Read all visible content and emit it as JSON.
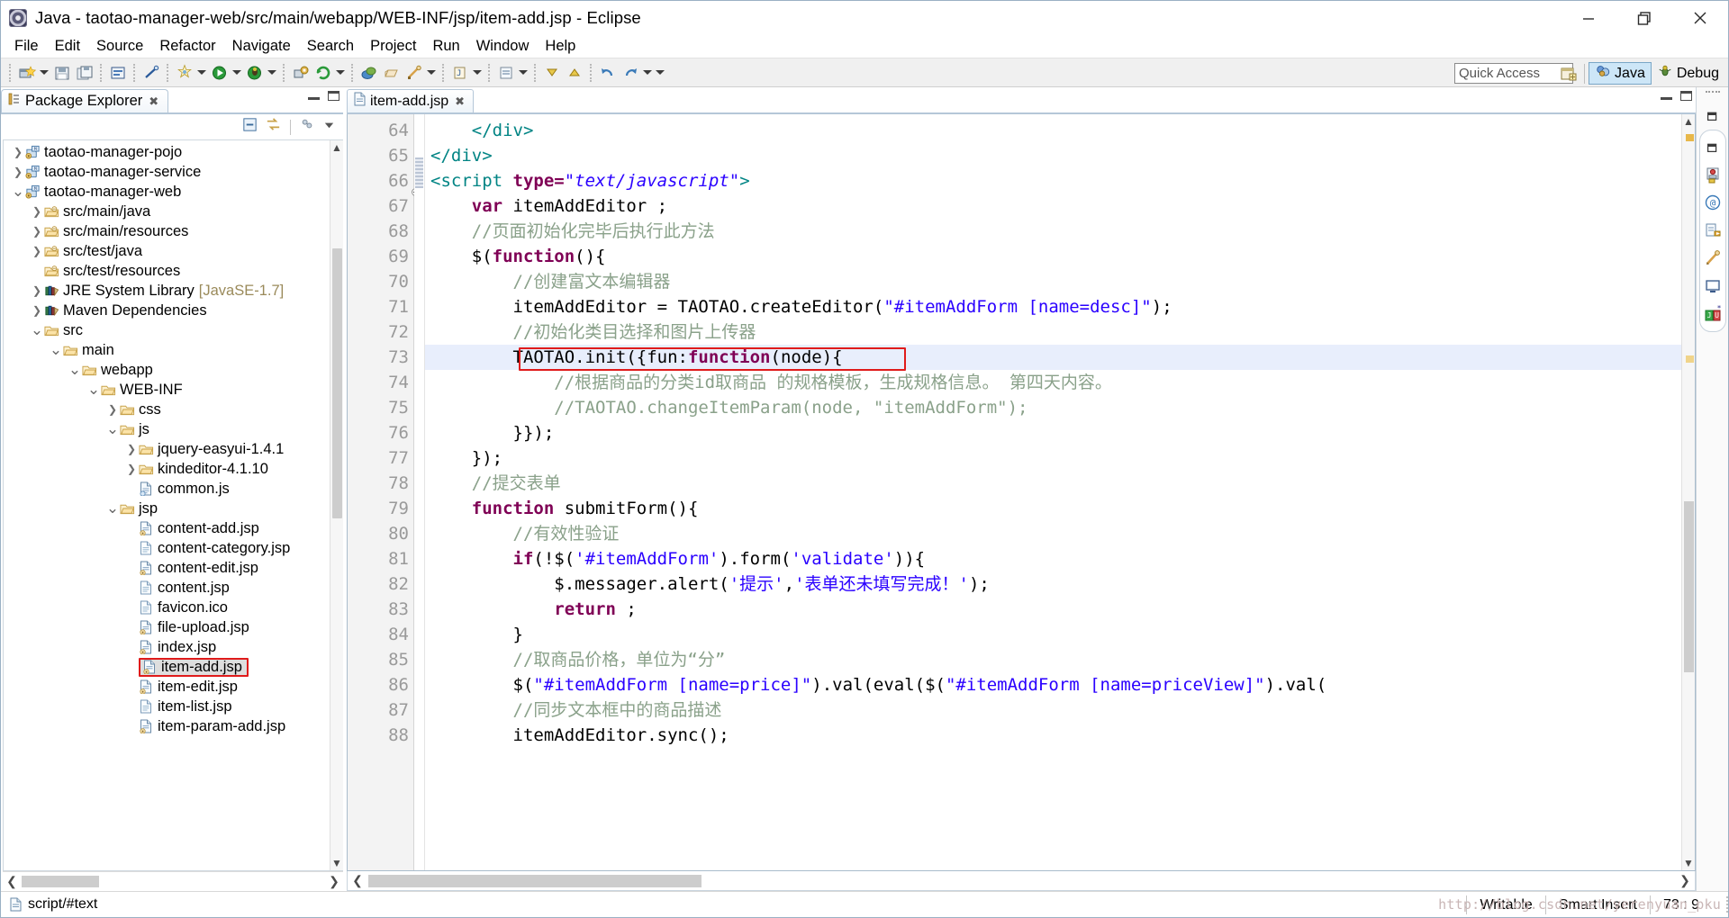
{
  "window": {
    "title": "Java - taotao-manager-web/src/main/webapp/WEB-INF/jsp/item-add.jsp - Eclipse",
    "app_icon": "eclipse-icon",
    "minimize": "—",
    "maximize": "❐",
    "close": "✕"
  },
  "menubar": {
    "items": [
      {
        "label": "File"
      },
      {
        "label": "Edit"
      },
      {
        "label": "Source"
      },
      {
        "label": "Refactor"
      },
      {
        "label": "Navigate"
      },
      {
        "label": "Search"
      },
      {
        "label": "Project"
      },
      {
        "label": "Run"
      },
      {
        "label": "Window"
      },
      {
        "label": "Help"
      }
    ]
  },
  "toolbar": {
    "quick_access_placeholder": "Quick Access",
    "open_perspective_icon": "open-perspective-icon",
    "perspectives": [
      {
        "label": "Java",
        "icon": "java-perspective-icon",
        "active": true
      },
      {
        "label": "Debug",
        "icon": "debug-perspective-icon",
        "active": false
      }
    ]
  },
  "package_explorer": {
    "tab_label": "Package Explorer",
    "tab_close": "✖",
    "toolbar_icons": [
      "collapse-all-icon",
      "link-with-editor-icon",
      "view-menu-icon",
      "view-chevron-icon"
    ],
    "minimize_title": "Minimize",
    "maximize_title": "Maximize",
    "tree": [
      {
        "label": "taotao-manager-pojo",
        "depth": 0,
        "twist": "collapsed",
        "icon": "maven-project-icon"
      },
      {
        "label": "taotao-manager-service",
        "depth": 0,
        "twist": "collapsed",
        "icon": "maven-project-icon"
      },
      {
        "label": "taotao-manager-web",
        "depth": 0,
        "twist": "expanded",
        "icon": "maven-project-icon"
      },
      {
        "label": "src/main/java",
        "depth": 1,
        "twist": "collapsed",
        "icon": "source-folder-icon"
      },
      {
        "label": "src/main/resources",
        "depth": 1,
        "twist": "collapsed",
        "icon": "source-folder-icon"
      },
      {
        "label": "src/test/java",
        "depth": 1,
        "twist": "collapsed",
        "icon": "source-folder-icon"
      },
      {
        "label": "src/test/resources",
        "depth": 1,
        "twist": "none",
        "icon": "source-folder-icon"
      },
      {
        "label": "JRE System Library",
        "suffix": "[JavaSE-1.7]",
        "depth": 1,
        "twist": "collapsed",
        "icon": "library-icon"
      },
      {
        "label": "Maven Dependencies",
        "depth": 1,
        "twist": "collapsed",
        "icon": "library-icon"
      },
      {
        "label": "src",
        "depth": 1,
        "twist": "expanded",
        "icon": "folder-icon"
      },
      {
        "label": "main",
        "depth": 2,
        "twist": "expanded",
        "icon": "folder-icon"
      },
      {
        "label": "webapp",
        "depth": 3,
        "twist": "expanded",
        "icon": "folder-icon"
      },
      {
        "label": "WEB-INF",
        "depth": 4,
        "twist": "expanded",
        "icon": "folder-icon"
      },
      {
        "label": "css",
        "depth": 5,
        "twist": "collapsed",
        "icon": "folder-icon"
      },
      {
        "label": "js",
        "depth": 5,
        "twist": "expanded",
        "icon": "folder-icon"
      },
      {
        "label": "jquery-easyui-1.4.1",
        "depth": 6,
        "twist": "collapsed",
        "icon": "folder-icon"
      },
      {
        "label": "kindeditor-4.1.10",
        "depth": 6,
        "twist": "collapsed",
        "icon": "folder-icon"
      },
      {
        "label": "common.js",
        "depth": 6,
        "twist": "none",
        "icon": "js-file-icon"
      },
      {
        "label": "jsp",
        "depth": 5,
        "twist": "expanded",
        "icon": "folder-icon"
      },
      {
        "label": "content-add.jsp",
        "depth": 6,
        "twist": "none",
        "icon": "jsp-file-icon"
      },
      {
        "label": "content-category.jsp",
        "depth": 6,
        "twist": "none",
        "icon": "file-icon"
      },
      {
        "label": "content-edit.jsp",
        "depth": 6,
        "twist": "none",
        "icon": "jsp-file-icon"
      },
      {
        "label": "content.jsp",
        "depth": 6,
        "twist": "none",
        "icon": "file-icon"
      },
      {
        "label": "favicon.ico",
        "depth": 6,
        "twist": "none",
        "icon": "file-icon"
      },
      {
        "label": "file-upload.jsp",
        "depth": 6,
        "twist": "none",
        "icon": "jsp-file-icon"
      },
      {
        "label": "index.jsp",
        "depth": 6,
        "twist": "none",
        "icon": "jsp-file-icon"
      },
      {
        "label": "item-add.jsp",
        "depth": 6,
        "twist": "none",
        "icon": "jsp-file-icon",
        "selected": true,
        "highlighted": true
      },
      {
        "label": "item-edit.jsp",
        "depth": 6,
        "twist": "none",
        "icon": "jsp-file-icon"
      },
      {
        "label": "item-list.jsp",
        "depth": 6,
        "twist": "none",
        "icon": "file-icon"
      },
      {
        "label": "item-param-add.jsp",
        "depth": 6,
        "twist": "none",
        "icon": "jsp-file-icon"
      }
    ]
  },
  "editor": {
    "tab_label": "item-add.jsp",
    "tab_icon": "jsp-file-icon",
    "tab_close": "✖",
    "current_line": 73,
    "first_line": 64,
    "lines": [
      {
        "n": 64,
        "fold": false,
        "tokens": [
          {
            "t": "    ",
            "c": ""
          },
          {
            "t": "</div>",
            "c": "tag"
          }
        ]
      },
      {
        "n": 65,
        "fold": false,
        "tokens": [
          {
            "t": "</div>",
            "c": "tag"
          }
        ]
      },
      {
        "n": 66,
        "fold": true,
        "tokens": [
          {
            "t": "<script ",
            "c": "tag"
          },
          {
            "t": "type=",
            "c": "attr"
          },
          {
            "t": "\"text/javascript\"",
            "c": "stri"
          },
          {
            "t": ">",
            "c": "tag"
          }
        ]
      },
      {
        "n": 67,
        "fold": false,
        "tokens": [
          {
            "t": "    ",
            "c": ""
          },
          {
            "t": "var",
            "c": "kw"
          },
          {
            "t": " itemAddEditor ;",
            "c": ""
          }
        ]
      },
      {
        "n": 68,
        "fold": false,
        "tokens": [
          {
            "t": "    //页面初始化完毕后执行此方法",
            "c": "cmt"
          }
        ]
      },
      {
        "n": 69,
        "fold": false,
        "tokens": [
          {
            "t": "    $(",
            "c": ""
          },
          {
            "t": "function",
            "c": "kw"
          },
          {
            "t": "(){",
            "c": ""
          }
        ]
      },
      {
        "n": 70,
        "fold": false,
        "tokens": [
          {
            "t": "        //创建富文本编辑器",
            "c": "cmt"
          }
        ]
      },
      {
        "n": 71,
        "fold": false,
        "tokens": [
          {
            "t": "        itemAddEditor = TAOTAO.createEditor(",
            "c": ""
          },
          {
            "t": "\"#itemAddForm [name=desc]\"",
            "c": "str"
          },
          {
            "t": ");",
            "c": ""
          }
        ]
      },
      {
        "n": 72,
        "fold": false,
        "tokens": [
          {
            "t": "        //初始化类目选择和图片上传器",
            "c": "cmt"
          }
        ]
      },
      {
        "n": 73,
        "fold": false,
        "current": true,
        "boxed": true,
        "tokens": [
          {
            "t": "        TAOTAO.init({fun:",
            "c": ""
          },
          {
            "t": "function",
            "c": "kw"
          },
          {
            "t": "(node){",
            "c": ""
          }
        ]
      },
      {
        "n": 74,
        "fold": false,
        "tokens": [
          {
            "t": "            //根据商品的分类id取商品 的规格模板，生成规格信息。 第四天内容。",
            "c": "cmt"
          }
        ]
      },
      {
        "n": 75,
        "fold": false,
        "tokens": [
          {
            "t": "            //TAOTAO.changeItemParam(node, \"itemAddForm\");",
            "c": "cmt"
          }
        ]
      },
      {
        "n": 76,
        "fold": false,
        "tokens": [
          {
            "t": "        }});",
            "c": ""
          }
        ]
      },
      {
        "n": 77,
        "fold": false,
        "tokens": [
          {
            "t": "    });",
            "c": ""
          }
        ]
      },
      {
        "n": 78,
        "fold": false,
        "tokens": [
          {
            "t": "    //提交表单",
            "c": "cmt"
          }
        ]
      },
      {
        "n": 79,
        "fold": false,
        "tokens": [
          {
            "t": "    ",
            "c": ""
          },
          {
            "t": "function",
            "c": "kw"
          },
          {
            "t": " submitForm(){",
            "c": ""
          }
        ]
      },
      {
        "n": 80,
        "fold": false,
        "tokens": [
          {
            "t": "        //有效性验证",
            "c": "cmt"
          }
        ]
      },
      {
        "n": 81,
        "fold": false,
        "tokens": [
          {
            "t": "        ",
            "c": ""
          },
          {
            "t": "if",
            "c": "kw"
          },
          {
            "t": "(!$(",
            "c": ""
          },
          {
            "t": "'#itemAddForm'",
            "c": "str"
          },
          {
            "t": ").form(",
            "c": ""
          },
          {
            "t": "'validate'",
            "c": "str"
          },
          {
            "t": ")){",
            "c": ""
          }
        ]
      },
      {
        "n": 82,
        "fold": false,
        "tokens": [
          {
            "t": "            $.messager.alert(",
            "c": ""
          },
          {
            "t": "'提示'",
            "c": "str"
          },
          {
            "t": ",",
            "c": ""
          },
          {
            "t": "'表单还未填写完成！'",
            "c": "str"
          },
          {
            "t": ");",
            "c": ""
          }
        ]
      },
      {
        "n": 83,
        "fold": false,
        "tokens": [
          {
            "t": "            ",
            "c": ""
          },
          {
            "t": "return",
            "c": "kw"
          },
          {
            "t": " ;",
            "c": ""
          }
        ]
      },
      {
        "n": 84,
        "fold": false,
        "tokens": [
          {
            "t": "        }",
            "c": ""
          }
        ]
      },
      {
        "n": 85,
        "fold": false,
        "tokens": [
          {
            "t": "        //取商品价格，单位为“分”",
            "c": "cmt"
          }
        ]
      },
      {
        "n": 86,
        "fold": false,
        "tokens": [
          {
            "t": "        $(",
            "c": ""
          },
          {
            "t": "\"#itemAddForm [name=price]\"",
            "c": "str"
          },
          {
            "t": ").val(eval($(",
            "c": ""
          },
          {
            "t": "\"#itemAddForm [name=priceView]\"",
            "c": "str"
          },
          {
            "t": ").val(",
            "c": ""
          }
        ]
      },
      {
        "n": 87,
        "fold": false,
        "tokens": [
          {
            "t": "        //同步文本框中的商品描述",
            "c": "cmt"
          }
        ]
      },
      {
        "n": 88,
        "fold": false,
        "partial": true,
        "tokens": [
          {
            "t": "        itemAddEditor.sync();",
            "c": ""
          }
        ]
      }
    ]
  },
  "right_fast_view": {
    "icons": [
      "restore-icon",
      "servers-view-icon",
      "at-console-icon",
      "problems-view-icon",
      "javadoc-view-icon",
      "console-view-icon",
      "junit-view-icon"
    ]
  },
  "statusbar": {
    "selection_icon": "file-icon",
    "selection": "script/#text",
    "writable": "Writable",
    "insert_mode": "Smart Insert",
    "position": "73 : 9",
    "watermark": "http://blog.csdn.net/yerenyuan_pku"
  },
  "colors": {
    "keyword": "#7f0055",
    "comment": "#8aa18a",
    "string": "#2a00ff",
    "tag": "#008484",
    "annotation_red": "#e01b1b",
    "current_line": "#e8eefc",
    "perspective_active": "#cde6f7"
  }
}
